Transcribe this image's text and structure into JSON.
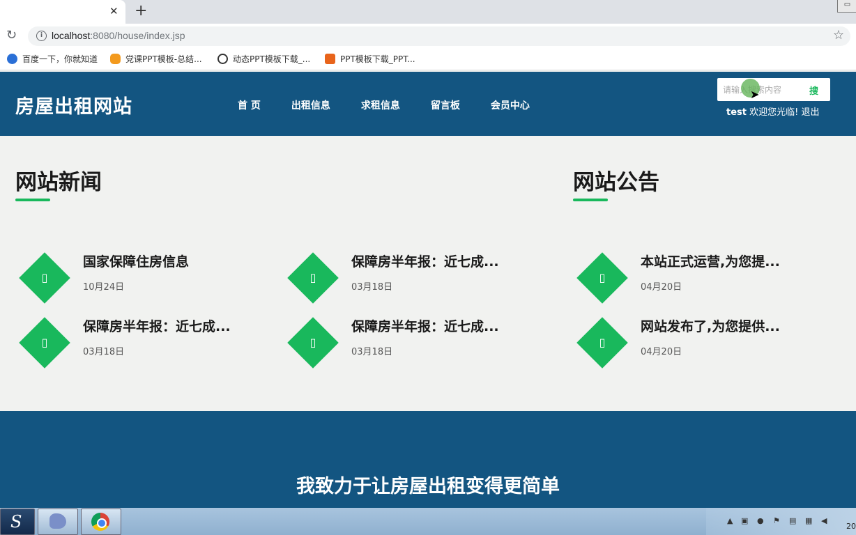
{
  "browser": {
    "tab_close": "✕",
    "new_tab": "+",
    "minimize": "▭",
    "url_host": "localhost",
    "url_path": ":8080/house/index.jsp",
    "bookmarks": [
      {
        "label": "百度一下，你就知道",
        "icon": "baidu-paw-icon",
        "color": "#2a6fd6"
      },
      {
        "label": "党课PPT模板-总结...",
        "icon": "orange-rounded-icon",
        "color": "#f39a1e"
      },
      {
        "label": "动态PPT模板下载_...",
        "icon": "panda-icon",
        "color": "#333333"
      },
      {
        "label": "PPT模板下载_PPT...",
        "icon": "orange-square-icon",
        "color": "#e8641b"
      }
    ]
  },
  "site": {
    "logo": "房屋出租网站",
    "nav": [
      "首 页",
      "出租信息",
      "求租信息",
      "留言板",
      "会员中心"
    ],
    "search_placeholder": "请输入搜索内容",
    "search_button": "搜",
    "user": "test",
    "welcome": " 欢迎您光临! ",
    "logout": "退出",
    "accent": "#19b85c",
    "header_color": "#135581"
  },
  "news": {
    "title": "网站新闻",
    "items": [
      {
        "title": "国家保障住房信息",
        "date": "10月24日"
      },
      {
        "title": "保障房半年报：近七成...",
        "date": "03月18日"
      },
      {
        "title": "保障房半年报：近七成...",
        "date": "03月18日"
      },
      {
        "title": "保障房半年报：近七成...",
        "date": "03月18日"
      }
    ]
  },
  "notice": {
    "title": "网站公告",
    "items": [
      {
        "title": "本站正式运营,为您提...",
        "date": "04月20日"
      },
      {
        "title": "网站发布了,为您提供...",
        "date": "04月20日"
      }
    ]
  },
  "footer": {
    "slogan": "我致力于让房屋出租变得更简单"
  },
  "taskbar": {
    "clock": "20"
  }
}
